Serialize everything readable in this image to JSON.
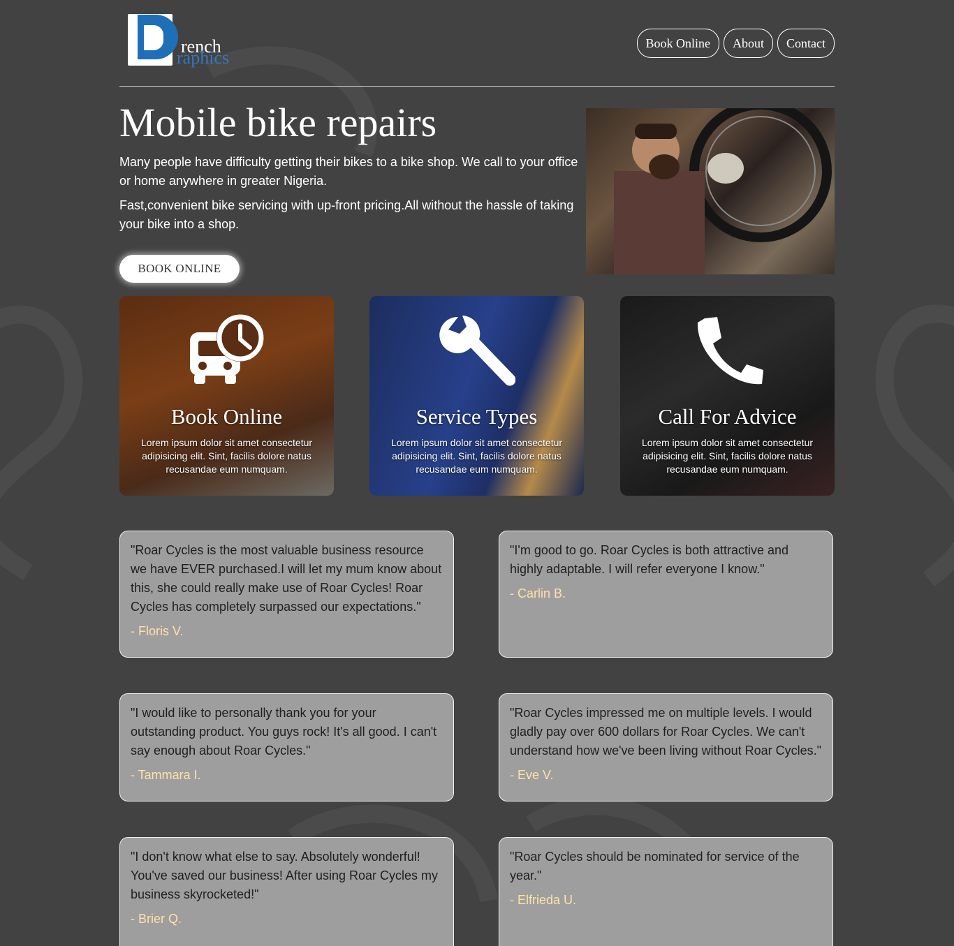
{
  "brand": {
    "name_line1": "rench",
    "name_line2": "raphics",
    "accent": "#1e6fb8"
  },
  "nav": [
    {
      "label": "Book Online"
    },
    {
      "label": "About"
    },
    {
      "label": "Contact"
    }
  ],
  "hero": {
    "title": "Mobile bike repairs",
    "paragraph1": "Many people have difficulty getting their bikes to a bike shop. We call to your office or home anywhere in greater Nigeria.",
    "paragraph2": "Fast,convenient bike servicing with up-front pricing.All without the hassle of taking your bike into a shop.",
    "button_label": "BOOK ONLINE"
  },
  "cards": [
    {
      "icon": "bus-clock-icon",
      "title": "Book Online",
      "text": "Lorem ipsum dolor sit amet consectetur adipisicing elit. Sint, facilis dolore natus recusandae eum numquam."
    },
    {
      "icon": "wrench-icon",
      "title": "Service Types",
      "text": "Lorem ipsum dolor sit amet consectetur adipisicing elit. Sint, facilis dolore natus recusandae eum numquam."
    },
    {
      "icon": "phone-icon",
      "title": "Call For Advice",
      "text": "Lorem ipsum dolor sit amet consectetur adipisicing elit. Sint, facilis dolore natus recusandae eum numquam."
    }
  ],
  "testimonials": [
    {
      "quote": "\"Roar Cycles is the most valuable business resource we have EVER purchased.I will let my mum know about this, she could really make use of Roar Cycles! Roar Cycles has completely surpassed our expectations.\"",
      "author": "- Floris V."
    },
    {
      "quote": "\"I'm good to go. Roar Cycles is both attractive and highly adaptable. I will refer everyone I know.\"",
      "author": "- Carlin B."
    },
    {
      "quote": "\"I would like to personally thank you for your outstanding product. You guys rock! It's all good. I can't say enough about Roar Cycles.\"",
      "author": "- Tammara I."
    },
    {
      "quote": "\"Roar Cycles impressed me on multiple levels. I would gladly pay over 600 dollars for Roar Cycles. We can't understand how we've been living without Roar Cycles.\"",
      "author": "- Eve V."
    },
    {
      "quote": "\"I don't know what else to say. Absolutely wonderful! You've saved our business! After using Roar Cycles my business skyrocketed!\"",
      "author": "- Brier Q."
    },
    {
      "quote": "\"Roar Cycles should be nominated for service of the year.\"",
      "author": "- Elfrieda U."
    }
  ]
}
